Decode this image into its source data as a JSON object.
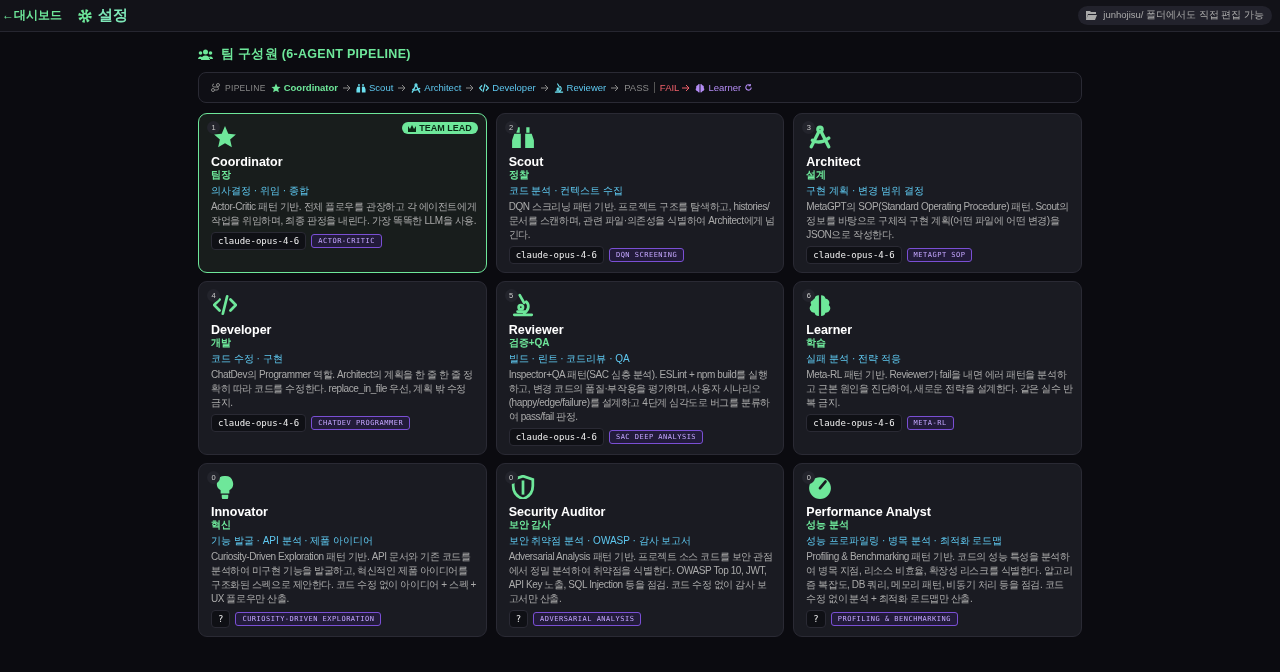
{
  "topbar": {
    "back": "←대시보드",
    "title": "설정",
    "notice": "junhojisu/ 폴더에서도 직접 편집 가능"
  },
  "section_title": "팀 구성원 (6-AGENT PIPELINE)",
  "pipeline": {
    "label": "PIPELINE",
    "steps": [
      {
        "label": "Coordinator",
        "kind": "lead"
      },
      {
        "label": "Scout",
        "kind": "agent"
      },
      {
        "label": "Architect",
        "kind": "agent"
      },
      {
        "label": "Developer",
        "kind": "agent"
      },
      {
        "label": "Reviewer",
        "kind": "agent"
      },
      {
        "label": "PASS",
        "kind": "pass"
      },
      {
        "label": "FAIL",
        "kind": "fail"
      },
      {
        "label": "Learner",
        "kind": "learner"
      }
    ]
  },
  "agents": [
    {
      "number": "1",
      "name": "Coordinator",
      "role": "팀장",
      "tags": "의사결정 · 위임 · 종합",
      "description": "Actor-Critic 패턴 기반. 전체 플로우를 관장하고 각 에이전트에게 작업을 위임하며, 최종 판정을 내린다. 가장 똑똑한 LLM을 사용.",
      "model": "claude-opus-4-6",
      "pattern": "ACTOR-CRITIC",
      "selected": true,
      "badge": "TEAM LEAD"
    },
    {
      "number": "2",
      "name": "Scout",
      "role": "정찰",
      "tags": "코드 분석 · 컨텍스트 수집",
      "description": "DQN 스크리닝 패턴 기반. 프로젝트 구조를 탐색하고, histories/ 문서를 스캔하며, 관련 파일·의존성을 식별하여 Architect에게 넘긴다.",
      "model": "claude-opus-4-6",
      "pattern": "DQN SCREENING",
      "selected": false
    },
    {
      "number": "3",
      "name": "Architect",
      "role": "설계",
      "tags": "구현 계획 · 변경 범위 결정",
      "description": "MetaGPT의 SOP(Standard Operating Procedure) 패턴. Scout의 정보를 바탕으로 구체적 구현 계획(어떤 파일에 어떤 변경)을 JSON으로 작성한다.",
      "model": "claude-opus-4-6",
      "pattern": "METAGPT SOP",
      "selected": false
    },
    {
      "number": "4",
      "name": "Developer",
      "role": "개발",
      "tags": "코드 수정 · 구현",
      "description": "ChatDev의 Programmer 역할. Architect의 계획을 한 줄 한 줄 정확히 따라 코드를 수정한다. replace_in_file 우선, 계획 밖 수정 금지.",
      "model": "claude-opus-4-6",
      "pattern": "CHATDEV PROGRAMMER",
      "selected": false
    },
    {
      "number": "5",
      "name": "Reviewer",
      "role": "검증+QA",
      "tags": "빌드 · 린트 · 코드리뷰 · QA",
      "description": "Inspector+QA 패턴(SAC 심층 분석). ESLint + npm build를 실행하고, 변경 코드의 품질·부작용을 평가하며, 사용자 시나리오(happy/edge/failure)를 설계하고 4단계 심각도로 버그를 분류하여 pass/fail 판정.",
      "model": "claude-opus-4-6",
      "pattern": "SAC DEEP ANALYSIS",
      "selected": false
    },
    {
      "number": "6",
      "name": "Learner",
      "role": "학습",
      "tags": "실패 분석 · 전략 적응",
      "description": "Meta-RL 패턴 기반. Reviewer가 fail을 내면 에러 패턴을 분석하고 근본 원인을 진단하여, 새로운 전략을 설계한다. 같은 실수 반복 금지.",
      "model": "claude-opus-4-6",
      "pattern": "META-RL",
      "selected": false
    },
    {
      "number": "0",
      "name": "Innovator",
      "role": "혁신",
      "tags": "기능 발굴 · API 분석 · 제품 아이디어",
      "description": "Curiosity-Driven Exploration 패턴 기반. API 문서와 기존 코드를 분석하여 미구현 기능을 발굴하고, 혁신적인 제품 아이디어를 구조화된 스펙으로 제안한다. 코드 수정 없이 아이디어 + 스펙 + UX 플로우만 산출.",
      "model": "?",
      "pattern": "CURIOSITY-DRIVEN EXPLORATION",
      "selected": false
    },
    {
      "number": "0",
      "name": "Security Auditor",
      "role": "보안 감사",
      "tags": "보안 취약점 분석 · OWASP · 감사 보고서",
      "description": "Adversarial Analysis 패턴 기반. 프로젝트 소스 코드를 보안 관점에서 정밀 분석하여 취약점을 식별한다. OWASP Top 10, JWT, API Key 노출, SQL Injection 등을 점검. 코드 수정 없이 감사 보고서만 산출.",
      "model": "?",
      "pattern": "ADVERSARIAL ANALYSIS",
      "selected": false
    },
    {
      "number": "0",
      "name": "Performance Analyst",
      "role": "성능 분석",
      "tags": "성능 프로파일링 · 병목 분석 · 최적화 로드맵",
      "description": "Profiling & Benchmarking 패턴 기반. 코드의 성능 특성을 분석하여 병목 지점, 리소스 비효율, 확장성 리스크를 식별한다. 알고리즘 복잡도, DB 쿼리, 메모리 패턴, 비동기 처리 등을 점검. 코드 수정 없이 분석 + 최적화 로드맵만 산출.",
      "model": "?",
      "pattern": "PROFILING & BENCHMARKING",
      "selected": false
    }
  ]
}
